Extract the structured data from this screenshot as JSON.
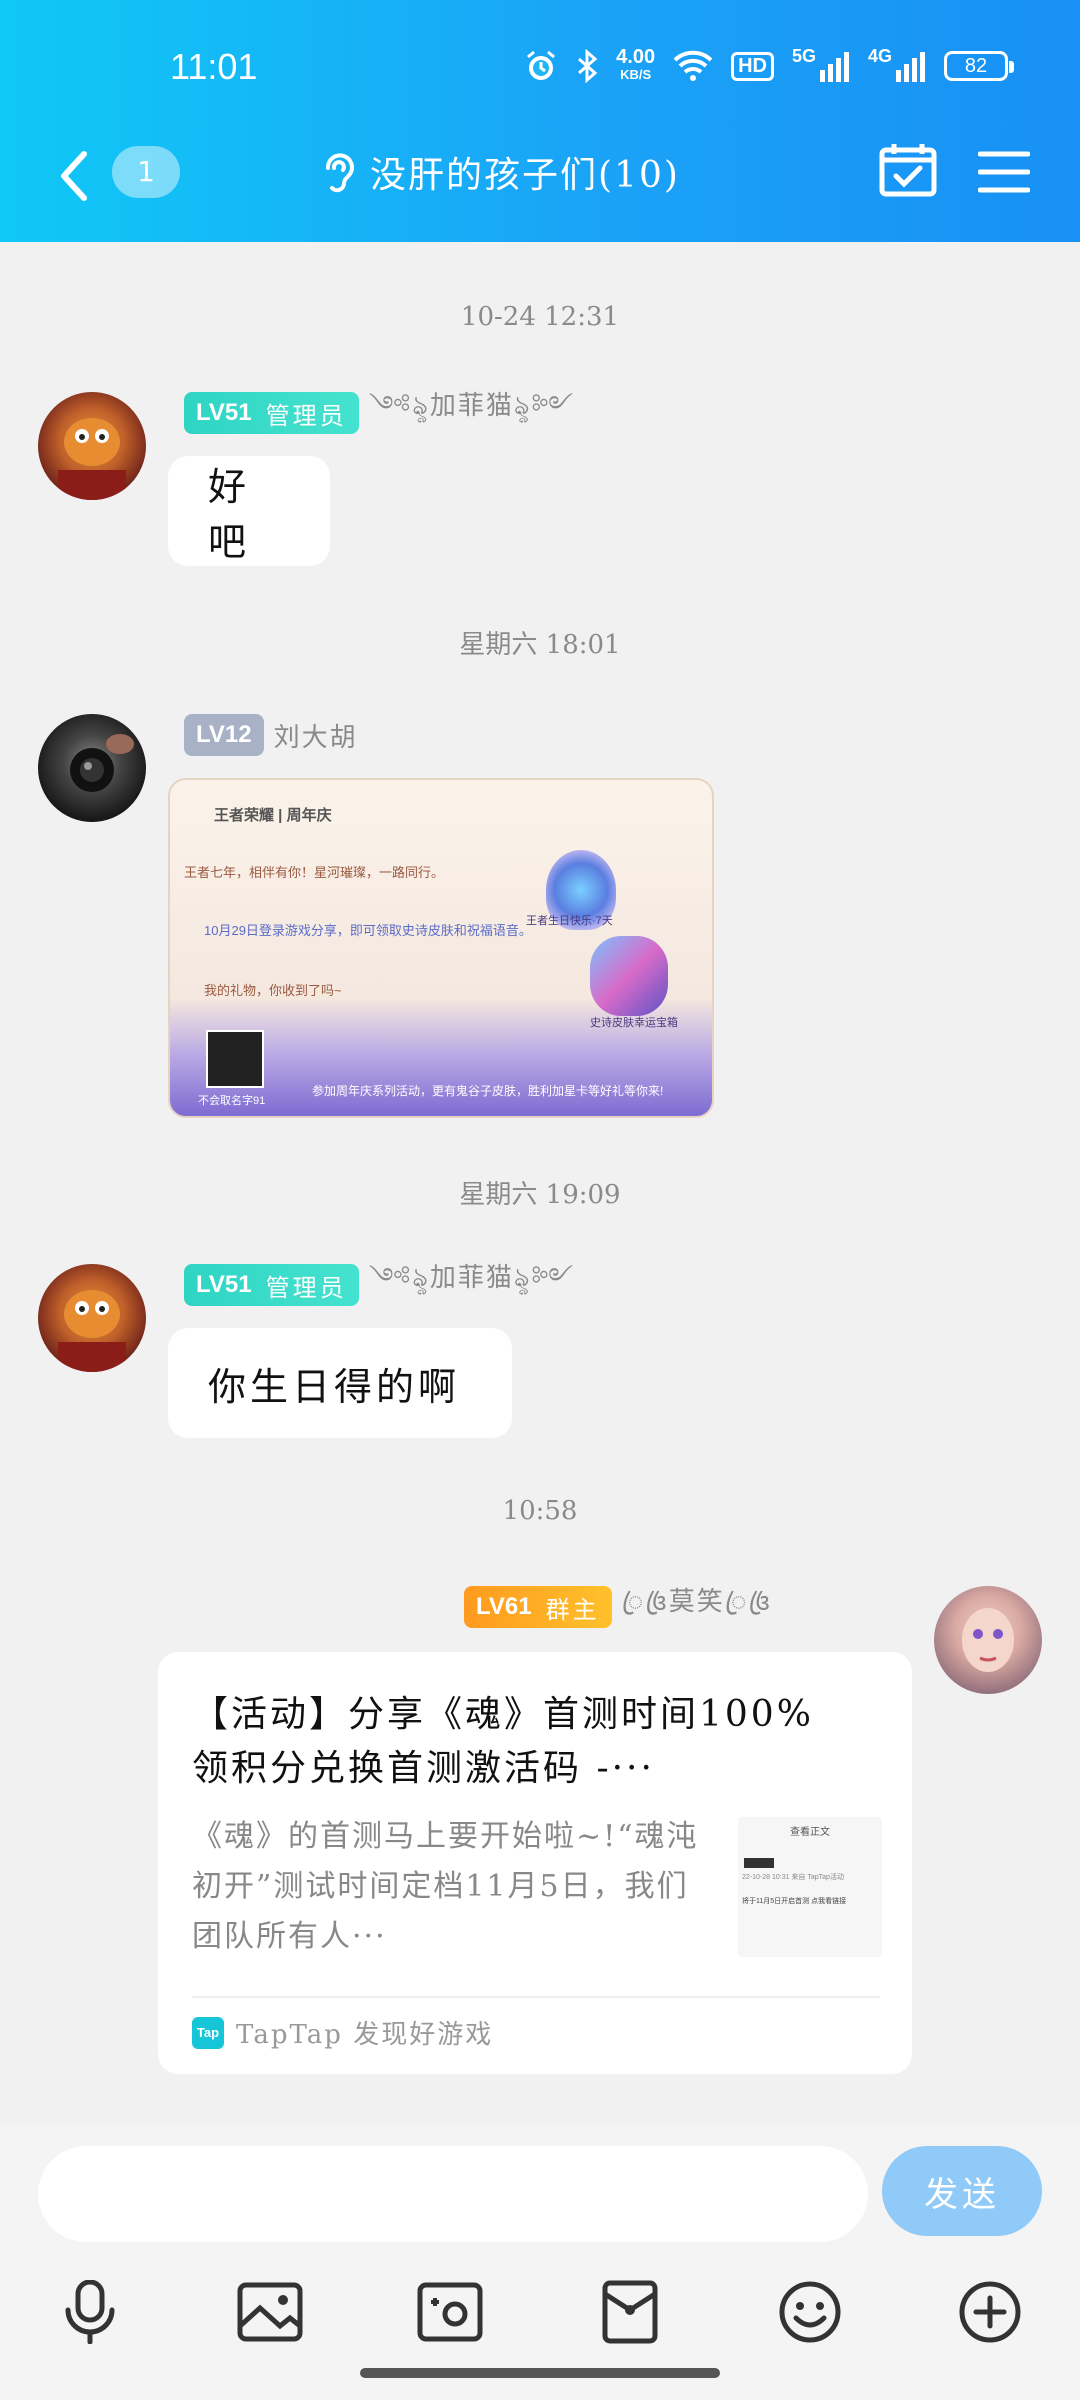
{
  "status_bar": {
    "time": "11:01",
    "speed": "4.00",
    "speed_unit": "KB/S",
    "hd": "HD",
    "net1": "5G",
    "net2": "4G",
    "battery": "82"
  },
  "header": {
    "unread_count": "1",
    "title": "没肝的孩子们(10)"
  },
  "messages": [
    {
      "timestamp": "10-24 12:31",
      "level": "LV51",
      "role": "管理员",
      "nickname": "༺ৡ加菲猫ৡ༻",
      "text": "好吧"
    },
    {
      "timestamp": "星期六 18:01",
      "level": "LV12",
      "nickname": "刘大胡",
      "image": {
        "line1": "王者七年，相伴有你！星河璀璨，一路同行。",
        "line2": "10月29日登录游戏分享，即可领取史诗皮肤和祝福语音。",
        "line3": "我的礼物，你收到了吗~",
        "badge1": "王者生日快乐·7天",
        "badge2": "史诗皮肤幸运宝箱",
        "footer": "参加周年庆系列活动，更有鬼谷子皮肤，胜利加星卡等好礼等你来!",
        "user": "不会取名字91",
        "brand1": "王者荣耀",
        "brand2": "周年庆"
      }
    },
    {
      "timestamp": "星期六 19:09",
      "level": "LV51",
      "role": "管理员",
      "nickname": "༺ৡ加菲猫ৡ༻",
      "text": "你生日得的啊"
    },
    {
      "timestamp": "10:58",
      "level": "LV61",
      "role": "群主",
      "nickname": "ꦿ꧔ꦿ莫笑ꦿ꧔ꦿ",
      "card": {
        "title": "【活动】分享《魂》首测时间100%领积分兑换首测激活码 -···",
        "desc": "《魂》的首测马上要开始啦~!“魂沌初开”测试时间定档11月5日，我们团队所有人···",
        "thumb_title": "查看正文",
        "thumb_text1": "22-10-28 10:31 来自 TapTap活动",
        "thumb_text2": "将于11月5日开启首测 点我看链接",
        "source": "TapTap 发现好游戏",
        "source_icon": "Tap"
      }
    }
  ],
  "input": {
    "placeholder": "",
    "send_label": "发送"
  },
  "colors": {
    "header_start": "#10c8f6",
    "header_end": "#1890f5",
    "send": "#8fcaf8"
  }
}
